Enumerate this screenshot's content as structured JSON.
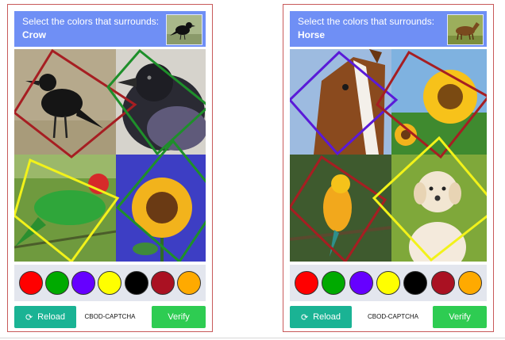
{
  "captchas": [
    {
      "prompt": "Select the colors that surrounds:",
      "target": "Crow",
      "thumbnail": "crow-thumbnail",
      "tiles": [
        "crow-on-grass",
        "crow-closeup",
        "green-parrot",
        "sunflower-blue-bg"
      ],
      "swatches": [
        "#ff0000",
        "#00aa00",
        "#6600ff",
        "#ffff00",
        "#000000",
        "#aa1122",
        "#ffaa00"
      ],
      "reload_label": "Reload",
      "brand": "CBOD-CAPTCHA",
      "verify_label": "Verify"
    },
    {
      "prompt": "Select the colors that surrounds:",
      "target": "Horse",
      "thumbnail": "horse-thumbnail",
      "tiles": [
        "horse-head",
        "sunflower",
        "parrot-on-branch",
        "puppy"
      ],
      "swatches": [
        "#ff0000",
        "#00aa00",
        "#6600ff",
        "#ffff00",
        "#000000",
        "#aa1122",
        "#ffaa00"
      ],
      "reload_label": "Reload",
      "brand": "CBOD-CAPTCHA",
      "verify_label": "Verify"
    }
  ],
  "accent": {
    "header": "#6f8ff5",
    "reload": "#1ab394",
    "verify": "#2ecc52"
  }
}
